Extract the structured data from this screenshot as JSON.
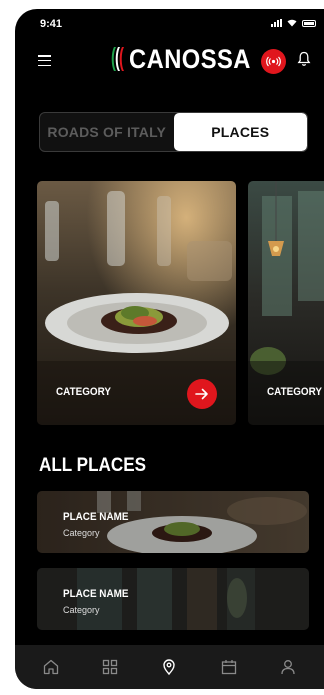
{
  "status_bar": {
    "time": "9:41"
  },
  "header": {
    "logo_text": "CANOSSA"
  },
  "tabs": [
    {
      "label": "ROADS OF ITALY",
      "active": false
    },
    {
      "label": "PLACES",
      "active": true
    }
  ],
  "categories": [
    {
      "label": "CATEGORY"
    },
    {
      "label": "CATEGORY"
    }
  ],
  "all_places": {
    "title": "ALL PLACES",
    "items": [
      {
        "name": "PLACE NAME",
        "category": "Category"
      },
      {
        "name": "PLACE NAME",
        "category": "Category"
      }
    ]
  },
  "bottom_nav": [
    "home-icon",
    "grid-icon",
    "location-pin-icon",
    "calendar-icon",
    "user-icon"
  ],
  "colors": {
    "accent": "#e0161d",
    "background": "#000000",
    "tab_active": "#ffffff"
  }
}
